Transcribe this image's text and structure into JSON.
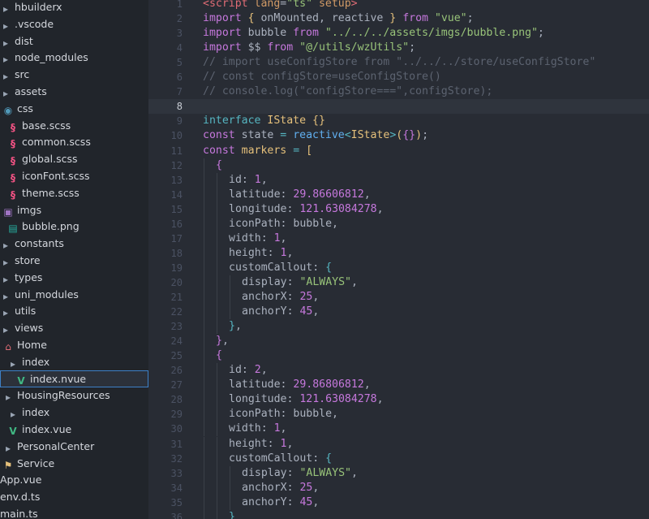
{
  "sidebar": {
    "items": [
      {
        "label": "hbuilderx",
        "icon": "folder-icon",
        "indent": 0
      },
      {
        "label": ".vscode",
        "icon": "folder-icon",
        "indent": 0
      },
      {
        "label": "dist",
        "icon": "folder-icon",
        "indent": 0
      },
      {
        "label": "node_modules",
        "icon": "folder-icon",
        "indent": 0
      },
      {
        "label": "src",
        "icon": "folder-icon",
        "indent": 0
      },
      {
        "label": "assets",
        "icon": "folder-icon",
        "indent": 1
      },
      {
        "label": "css",
        "icon": "css-folder-icon",
        "indent": 2
      },
      {
        "label": "base.scss",
        "icon": "scss-file-icon",
        "indent": 3
      },
      {
        "label": "common.scss",
        "icon": "scss-file-icon",
        "indent": 3
      },
      {
        "label": "global.scss",
        "icon": "scss-file-icon",
        "indent": 3
      },
      {
        "label": "iconFont.scss",
        "icon": "scss-file-icon",
        "indent": 3
      },
      {
        "label": "theme.scss",
        "icon": "scss-file-icon",
        "indent": 3
      },
      {
        "label": "imgs",
        "icon": "image-folder-icon",
        "indent": 2
      },
      {
        "label": "bubble.png",
        "icon": "png-file-icon",
        "indent": 3
      },
      {
        "label": "constants",
        "icon": "folder-icon",
        "indent": 1
      },
      {
        "label": "store",
        "icon": "folder-icon",
        "indent": 1
      },
      {
        "label": "types",
        "icon": "folder-icon",
        "indent": 1
      },
      {
        "label": "uni_modules",
        "icon": "folder-icon",
        "indent": 1
      },
      {
        "label": "utils",
        "icon": "folder-icon",
        "indent": 1
      },
      {
        "label": "views",
        "icon": "folder-icon",
        "indent": 1
      },
      {
        "label": "Home",
        "icon": "home-folder-icon",
        "indent": 2
      },
      {
        "label": "index",
        "icon": "folder-icon",
        "indent": 3
      },
      {
        "label": "index.nvue",
        "icon": "vue-file-icon",
        "indent": 4,
        "selected": true
      },
      {
        "label": "HousingResources",
        "icon": "folder-icon",
        "indent": 2
      },
      {
        "label": "index",
        "icon": "folder-icon",
        "indent": 3
      },
      {
        "label": "index.vue",
        "icon": "vue-file-icon",
        "indent": 3
      },
      {
        "label": "PersonalCenter",
        "icon": "folder-icon",
        "indent": 2
      },
      {
        "label": "Service",
        "icon": "service-folder-icon",
        "indent": 2
      },
      {
        "label": "App.vue",
        "icon": "none",
        "indent": 1
      },
      {
        "label": "env.d.ts",
        "icon": "none",
        "indent": 1
      },
      {
        "label": "main.ts",
        "icon": "none",
        "indent": 1
      }
    ]
  },
  "editor": {
    "current_line": 8,
    "lines": [
      {
        "n": "1",
        "tokens": [
          [
            "tag",
            "<script"
          ],
          [
            "plain",
            " "
          ],
          [
            "attr",
            "lang"
          ],
          [
            "plain",
            "="
          ],
          [
            "str",
            "\"ts\""
          ],
          [
            "plain",
            " "
          ],
          [
            "attr",
            "setup"
          ],
          [
            "tag",
            ">"
          ]
        ]
      },
      {
        "n": "2",
        "tokens": [
          [
            "kw",
            "import"
          ],
          [
            "plain",
            " "
          ],
          [
            "brk1",
            "{"
          ],
          [
            "plain",
            " onMounted, reactive "
          ],
          [
            "brk1",
            "}"
          ],
          [
            "plain",
            " "
          ],
          [
            "kw",
            "from"
          ],
          [
            "plain",
            " "
          ],
          [
            "str",
            "\"vue\""
          ],
          [
            "plain",
            ";"
          ]
        ]
      },
      {
        "n": "3",
        "tokens": [
          [
            "kw",
            "import"
          ],
          [
            "plain",
            " bubble "
          ],
          [
            "kw",
            "from"
          ],
          [
            "plain",
            " "
          ],
          [
            "str",
            "\"../../../assets/imgs/bubble.png\""
          ],
          [
            "plain",
            ";"
          ]
        ]
      },
      {
        "n": "4",
        "tokens": [
          [
            "kw",
            "import"
          ],
          [
            "plain",
            " $$ "
          ],
          [
            "kw",
            "from"
          ],
          [
            "plain",
            " "
          ],
          [
            "str",
            "\"@/utils/wzUtils\""
          ],
          [
            "plain",
            ";"
          ]
        ]
      },
      {
        "n": "5",
        "tokens": [
          [
            "cmt",
            "// import useConfigStore from \"../../../store/useConfigStore\""
          ]
        ]
      },
      {
        "n": "6",
        "tokens": [
          [
            "cmt",
            "// const configStore=useConfigStore()"
          ]
        ]
      },
      {
        "n": "7",
        "tokens": [
          [
            "cmt",
            "// console.log(\"configStore===\",configStore);"
          ]
        ]
      },
      {
        "n": "8",
        "tokens": []
      },
      {
        "n": "9",
        "tokens": [
          [
            "kw2",
            "interface"
          ],
          [
            "plain",
            " "
          ],
          [
            "type",
            "IState"
          ],
          [
            "plain",
            " "
          ],
          [
            "brk1",
            "{}"
          ]
        ]
      },
      {
        "n": "10",
        "tokens": [
          [
            "kw",
            "const"
          ],
          [
            "plain",
            " state "
          ],
          [
            "kw2",
            "="
          ],
          [
            "plain",
            " "
          ],
          [
            "fn",
            "reactive"
          ],
          [
            "kw2",
            "<"
          ],
          [
            "type",
            "IState"
          ],
          [
            "kw2",
            ">"
          ],
          [
            "brk1",
            "("
          ],
          [
            "brk2",
            "{}"
          ],
          [
            "brk1",
            ")"
          ],
          [
            "plain",
            ";"
          ]
        ]
      },
      {
        "n": "11",
        "tokens": [
          [
            "kw",
            "const"
          ],
          [
            "plain",
            " "
          ],
          [
            "type",
            "markers"
          ],
          [
            "plain",
            " "
          ],
          [
            "kw2",
            "="
          ],
          [
            "plain",
            " "
          ],
          [
            "brk1",
            "["
          ]
        ]
      },
      {
        "n": "12",
        "indent": 1,
        "tokens": [
          [
            "brk2",
            "{"
          ]
        ]
      },
      {
        "n": "13",
        "indent": 2,
        "tokens": [
          [
            "prop",
            "id: "
          ],
          [
            "num2",
            "1"
          ],
          [
            "plain",
            ","
          ]
        ]
      },
      {
        "n": "14",
        "indent": 2,
        "tokens": [
          [
            "prop",
            "latitude: "
          ],
          [
            "num2",
            "29.86606812"
          ],
          [
            "plain",
            ","
          ]
        ]
      },
      {
        "n": "15",
        "indent": 2,
        "tokens": [
          [
            "prop",
            "longitude: "
          ],
          [
            "num2",
            "121.63084278"
          ],
          [
            "plain",
            ","
          ]
        ]
      },
      {
        "n": "16",
        "indent": 2,
        "tokens": [
          [
            "prop",
            "iconPath: bubble,"
          ]
        ]
      },
      {
        "n": "17",
        "indent": 2,
        "tokens": [
          [
            "prop",
            "width: "
          ],
          [
            "num2",
            "1"
          ],
          [
            "plain",
            ","
          ]
        ]
      },
      {
        "n": "18",
        "indent": 2,
        "tokens": [
          [
            "prop",
            "height: "
          ],
          [
            "num2",
            "1"
          ],
          [
            "plain",
            ","
          ]
        ]
      },
      {
        "n": "19",
        "indent": 2,
        "tokens": [
          [
            "prop",
            "customCallout: "
          ],
          [
            "brk3",
            "{"
          ]
        ]
      },
      {
        "n": "20",
        "indent": 3,
        "tokens": [
          [
            "prop",
            "display: "
          ],
          [
            "str",
            "\"ALWAYS\""
          ],
          [
            "plain",
            ","
          ]
        ]
      },
      {
        "n": "21",
        "indent": 3,
        "tokens": [
          [
            "prop",
            "anchorX: "
          ],
          [
            "num2",
            "25"
          ],
          [
            "plain",
            ","
          ]
        ]
      },
      {
        "n": "22",
        "indent": 3,
        "tokens": [
          [
            "prop",
            "anchorY: "
          ],
          [
            "num2",
            "45"
          ],
          [
            "plain",
            ","
          ]
        ]
      },
      {
        "n": "23",
        "indent": 2,
        "tokens": [
          [
            "brk3",
            "}"
          ],
          [
            "plain",
            ","
          ]
        ]
      },
      {
        "n": "24",
        "indent": 1,
        "tokens": [
          [
            "brk2",
            "}"
          ],
          [
            "plain",
            ","
          ]
        ]
      },
      {
        "n": "25",
        "indent": 1,
        "tokens": [
          [
            "brk2",
            "{"
          ]
        ]
      },
      {
        "n": "26",
        "indent": 2,
        "tokens": [
          [
            "prop",
            "id: "
          ],
          [
            "num2",
            "2"
          ],
          [
            "plain",
            ","
          ]
        ]
      },
      {
        "n": "27",
        "indent": 2,
        "tokens": [
          [
            "prop",
            "latitude: "
          ],
          [
            "num2",
            "29.86806812"
          ],
          [
            "plain",
            ","
          ]
        ]
      },
      {
        "n": "28",
        "indent": 2,
        "tokens": [
          [
            "prop",
            "longitude: "
          ],
          [
            "num2",
            "121.63084278"
          ],
          [
            "plain",
            ","
          ]
        ]
      },
      {
        "n": "29",
        "indent": 2,
        "tokens": [
          [
            "prop",
            "iconPath: bubble,"
          ]
        ]
      },
      {
        "n": "30",
        "indent": 2,
        "tokens": [
          [
            "prop",
            "width: "
          ],
          [
            "num2",
            "1"
          ],
          [
            "plain",
            ","
          ]
        ]
      },
      {
        "n": "31",
        "indent": 2,
        "tokens": [
          [
            "prop",
            "height: "
          ],
          [
            "num2",
            "1"
          ],
          [
            "plain",
            ","
          ]
        ]
      },
      {
        "n": "32",
        "indent": 2,
        "tokens": [
          [
            "prop",
            "customCallout: "
          ],
          [
            "brk3",
            "{"
          ]
        ]
      },
      {
        "n": "33",
        "indent": 3,
        "tokens": [
          [
            "prop",
            "display: "
          ],
          [
            "str",
            "\"ALWAYS\""
          ],
          [
            "plain",
            ","
          ]
        ]
      },
      {
        "n": "34",
        "indent": 3,
        "tokens": [
          [
            "prop",
            "anchorX: "
          ],
          [
            "num2",
            "25"
          ],
          [
            "plain",
            ","
          ]
        ]
      },
      {
        "n": "35",
        "indent": 3,
        "tokens": [
          [
            "prop",
            "anchorY: "
          ],
          [
            "num2",
            "45"
          ],
          [
            "plain",
            ","
          ]
        ]
      },
      {
        "n": "36",
        "indent": 2,
        "tokens": [
          [
            "brk3",
            "}"
          ]
        ]
      }
    ]
  }
}
